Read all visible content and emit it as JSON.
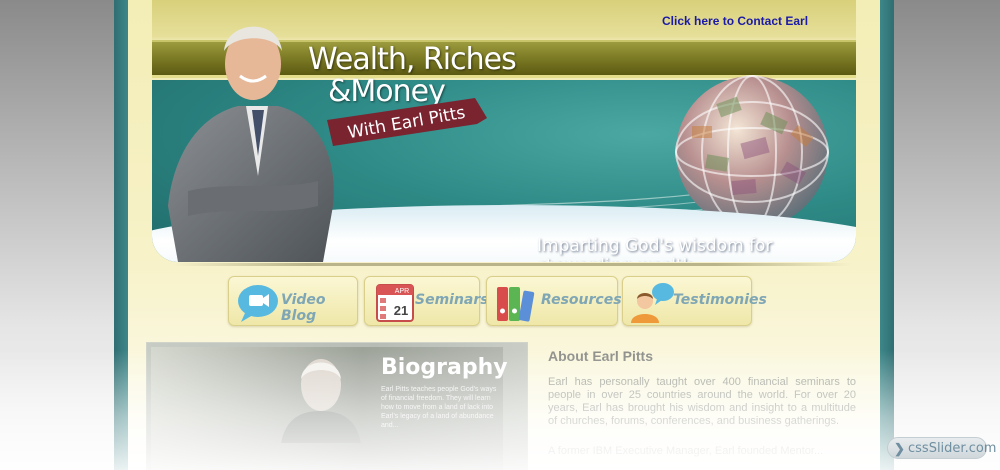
{
  "header": {
    "contact_link": "Click here to Contact Earl",
    "title_line1": "Wealth, Riches",
    "title_line2": "&Money",
    "subtitle": "With Earl Pitts",
    "tagline": "Imparting God's wisdom for stewarding wealth"
  },
  "nav": {
    "items": [
      {
        "label": "Video Blog",
        "icon": "video-chat-icon"
      },
      {
        "label": "Seminars",
        "icon": "calendar-icon",
        "calendar_month": "APR",
        "calendar_day": "21"
      },
      {
        "label": "Resources",
        "icon": "binders-icon"
      },
      {
        "label": "Testimonies",
        "icon": "speech-person-icon"
      }
    ]
  },
  "biography": {
    "title": "Biography",
    "text": "Earl Pitts teaches people God's ways of financial freedom. They will learn how to move from a land of lack into Earl's legacy of a land of abundance and..."
  },
  "about": {
    "title": "About Earl Pitts",
    "paragraph1": "Earl has personally taught over 400 financial seminars to people in over 25 countries around the world. For over 20 years, Earl has brought his wisdom and insight to a multitude of churches, forums, conferences, and business gatherings.",
    "paragraph2": "A former IBM Executive Manager, Earl founded Mentor..."
  },
  "watermark": {
    "arrow": "❯",
    "text": "cssSlider.com"
  },
  "colors": {
    "link": "#1a1aa6",
    "teal": "#2e8a86",
    "olive": "#7b7a24",
    "cream": "#f6efb8",
    "ribbon": "#7a2430"
  }
}
